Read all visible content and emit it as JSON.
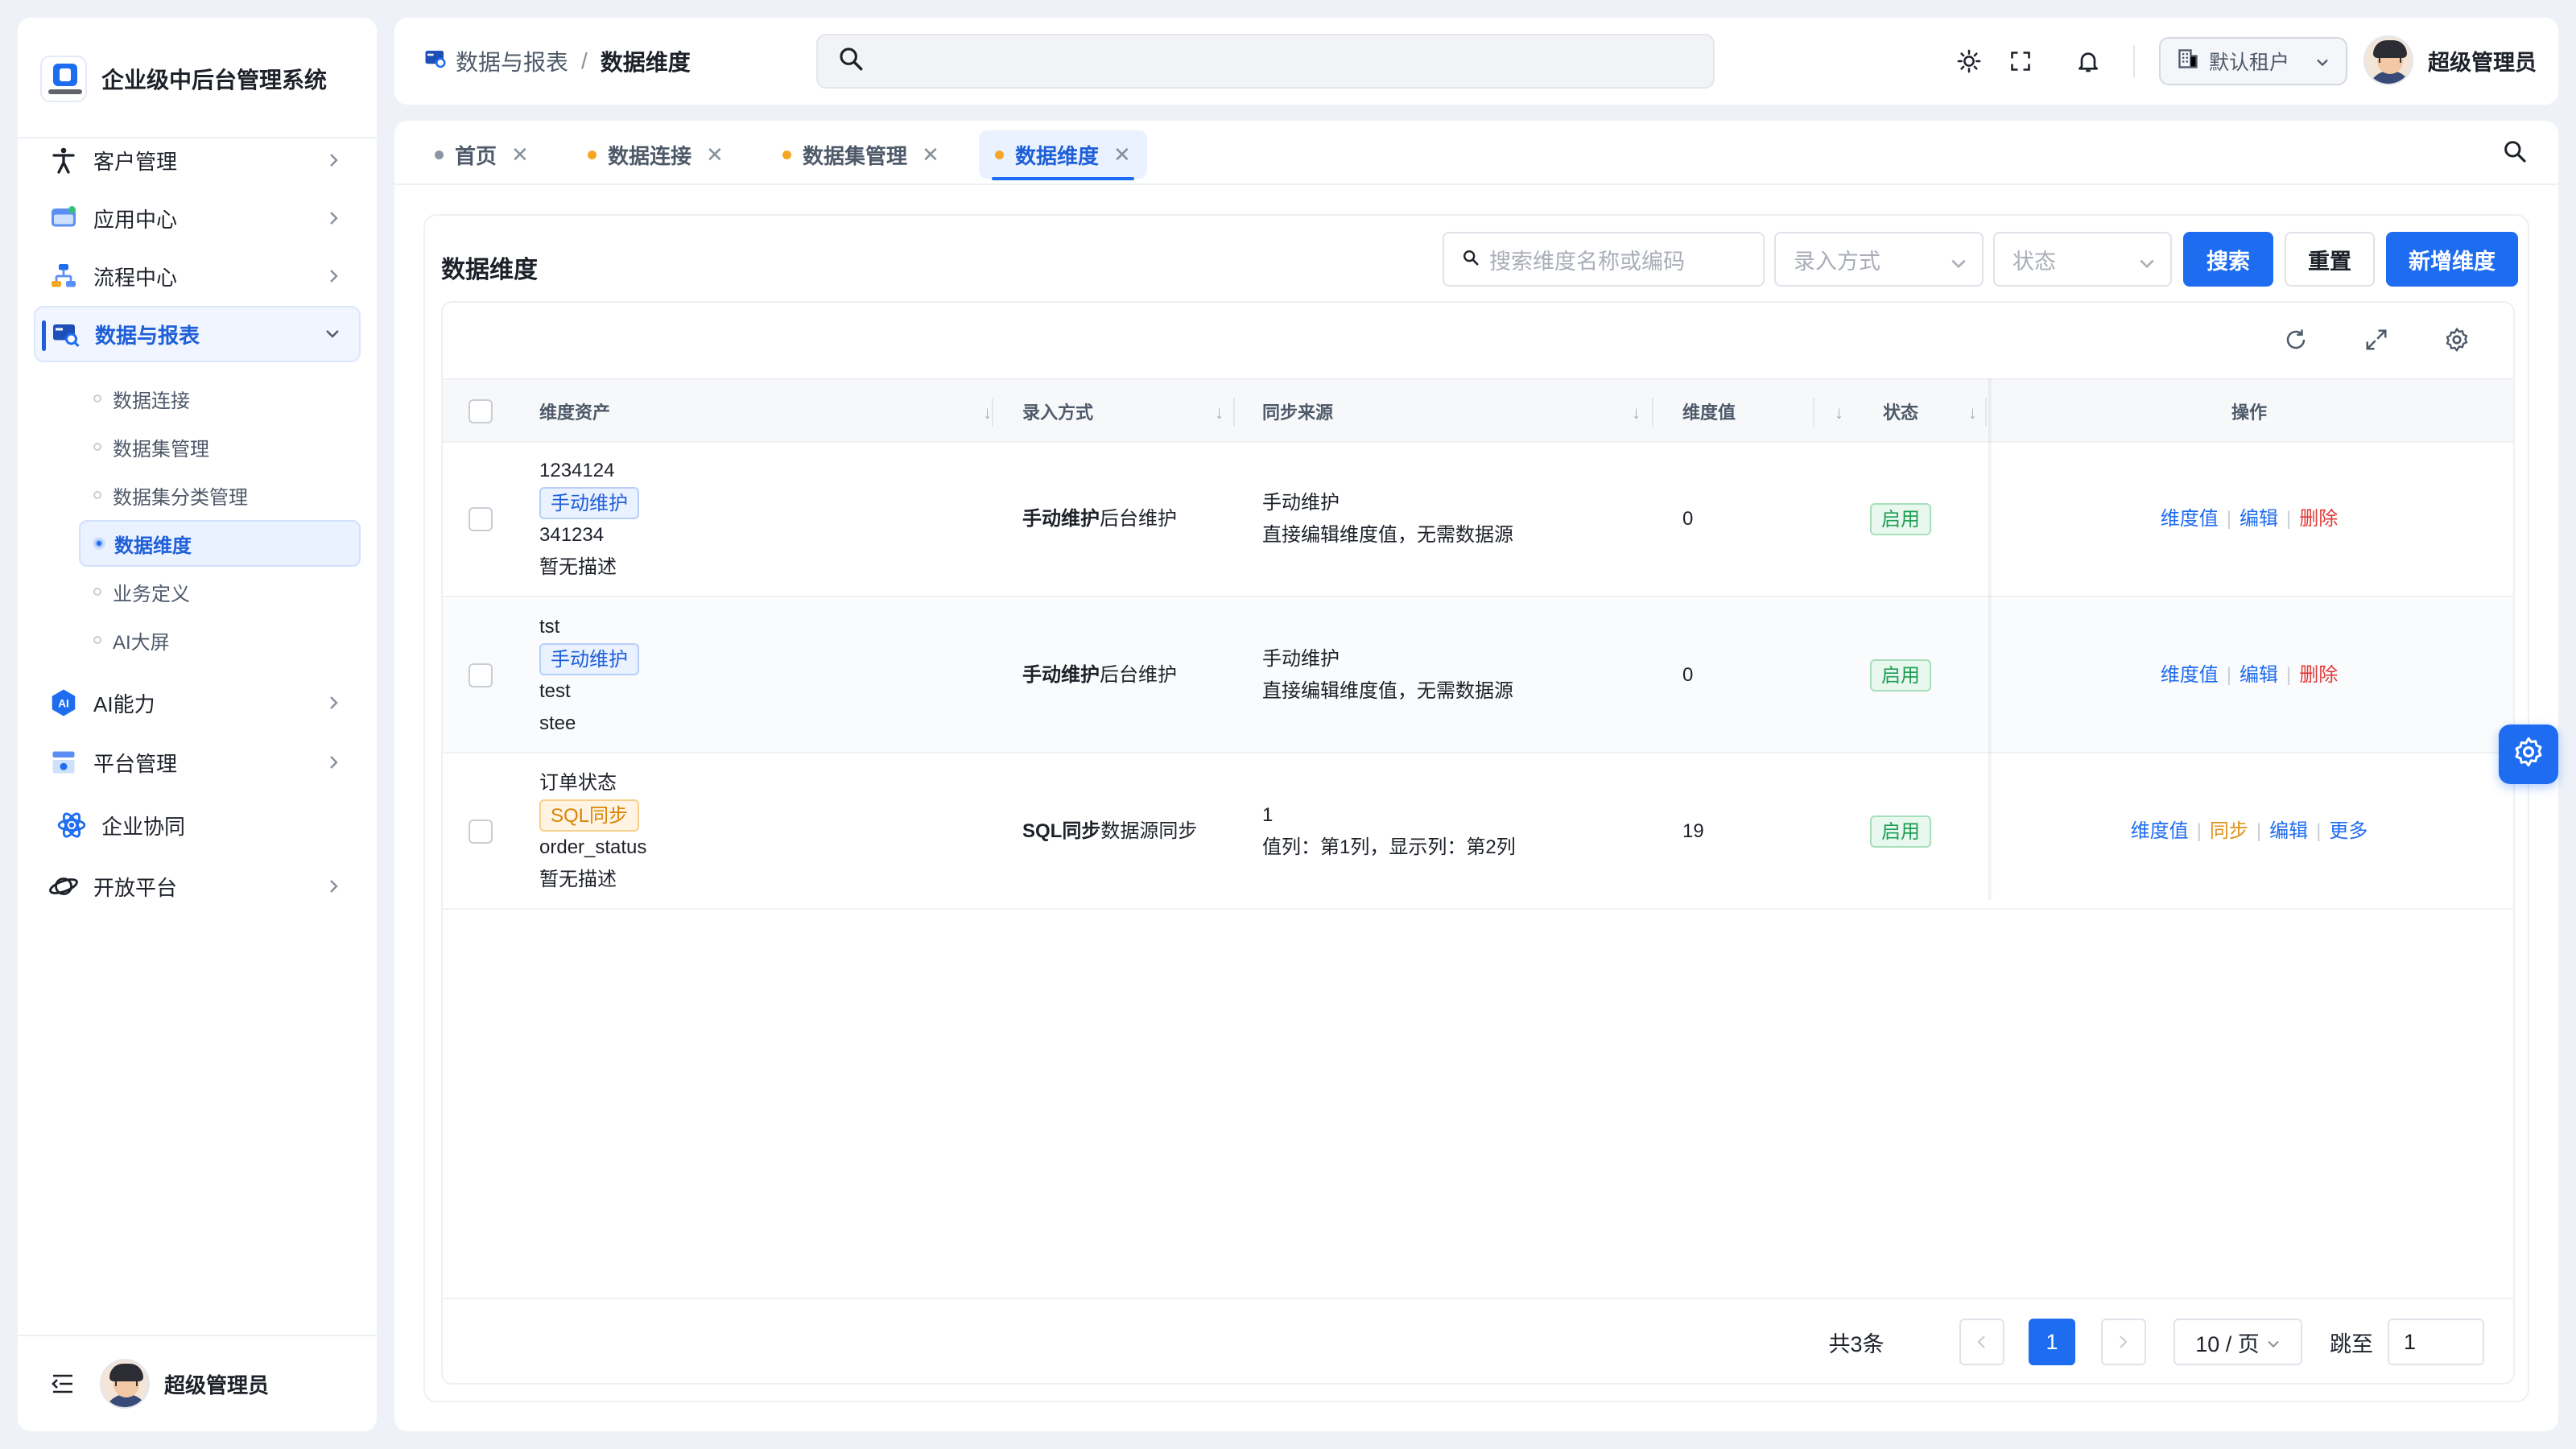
{
  "app": {
    "title": "企业级中后台管理系统"
  },
  "sidebar": {
    "items": [
      {
        "label": "客户管理",
        "icon": "person-icon"
      },
      {
        "label": "应用中心",
        "icon": "app-window-icon"
      },
      {
        "label": "流程中心",
        "icon": "flow-icon"
      },
      {
        "label": "数据与报表",
        "icon": "data-report-icon",
        "active": true
      },
      {
        "label": "AI能力",
        "icon": "ai-icon"
      },
      {
        "label": "平台管理",
        "icon": "platform-icon"
      },
      {
        "label": "企业协同",
        "icon": "atom-icon"
      },
      {
        "label": "开放平台",
        "icon": "planet-icon"
      }
    ],
    "subitems": [
      {
        "label": "数据连接"
      },
      {
        "label": "数据集管理"
      },
      {
        "label": "数据集分类管理"
      },
      {
        "label": "数据维度",
        "active": true
      },
      {
        "label": "业务定义"
      },
      {
        "label": "AI大屏"
      }
    ],
    "footer_user": "超级管理员"
  },
  "header": {
    "breadcrumb": [
      "数据与报表",
      "数据维度"
    ],
    "search_placeholder": "",
    "tenant": "默认租户",
    "user": "超级管理员"
  },
  "tabs": [
    {
      "label": "首页",
      "dot_color": "#8c95a3"
    },
    {
      "label": "数据连接",
      "dot_color": "#f5a623"
    },
    {
      "label": "数据集管理",
      "dot_color": "#f5a623"
    },
    {
      "label": "数据维度",
      "dot_color": "#f5a623",
      "active": true
    }
  ],
  "panel": {
    "title": "数据维度",
    "filters": {
      "search_placeholder": "搜索维度名称或编码",
      "entry_mode_placeholder": "录入方式",
      "status_placeholder": "状态"
    },
    "buttons": {
      "search": "搜索",
      "reset": "重置",
      "add": "新增维度"
    }
  },
  "table": {
    "columns": [
      "维度资产",
      "录入方式",
      "同步来源",
      "维度值",
      "状态",
      "操作"
    ],
    "rows": [
      {
        "name": "1234124",
        "tag": "手动维护",
        "tag_color": "blue",
        "code": "341234",
        "desc": "暂无描述",
        "mode_bold": "手动维护",
        "mode_rest": "后台维护",
        "source_title": "手动维护",
        "source_detail": "直接编辑维度值，无需数据源",
        "value_count": "0",
        "status": "启用",
        "actions": [
          "维度值",
          "编辑",
          "删除"
        ]
      },
      {
        "name": "tst",
        "tag": "手动维护",
        "tag_color": "blue",
        "code": "test",
        "desc": "stee",
        "mode_bold": "手动维护",
        "mode_rest": "后台维护",
        "source_title": "手动维护",
        "source_detail": "直接编辑维度值，无需数据源",
        "value_count": "0",
        "status": "启用",
        "actions": [
          "维度值",
          "编辑",
          "删除"
        ]
      },
      {
        "name": "订单状态",
        "tag": "SQL同步",
        "tag_color": "orange",
        "code": "order_status",
        "desc": "暂无描述",
        "mode_bold": "SQL同步",
        "mode_rest": "数据源同步",
        "source_title": "1",
        "source_detail": "值列：第1列，显示列：第2列",
        "value_count": "19",
        "status": "启用",
        "actions": [
          "维度值",
          "同步",
          "编辑",
          "更多"
        ]
      }
    ]
  },
  "pagination": {
    "total": "共3条",
    "current": "1",
    "page_size": "10 / 页",
    "jump_label": "跳至",
    "jump_value": "1"
  },
  "colors": {
    "primary": "#1e6cf0",
    "success": "#1e9e55",
    "danger": "#e03a3a",
    "warning": "#e0921a"
  }
}
